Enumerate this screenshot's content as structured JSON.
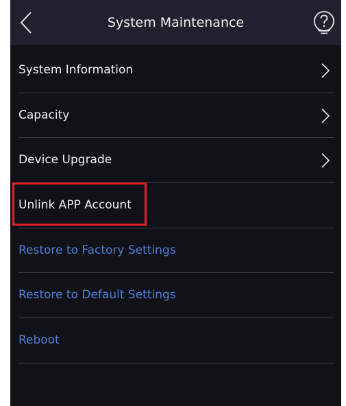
{
  "header": {
    "title": "System Maintenance",
    "back_icon": "chevron-left-icon",
    "help_icon": "help-icon"
  },
  "menu": {
    "items": [
      {
        "label": "System Information",
        "has_chevron": true,
        "color": "#f0f0f0"
      },
      {
        "label": "Capacity",
        "has_chevron": true,
        "color": "#f0f0f0"
      },
      {
        "label": "Device Upgrade",
        "has_chevron": true,
        "color": "#f0f0f0"
      },
      {
        "label": "Unlink APP Account",
        "has_chevron": false,
        "color": "#f0f0f0",
        "highlighted": true
      },
      {
        "label": "Restore to Factory Settings",
        "has_chevron": false,
        "color": "#4f7fd6"
      },
      {
        "label": "Restore to Default Settings",
        "has_chevron": false,
        "color": "#4f7fd6"
      },
      {
        "label": "Reboot",
        "has_chevron": false,
        "color": "#4f7fd6"
      }
    ]
  },
  "colors": {
    "background": "#111118",
    "header": "#20212e",
    "accent_link": "#4f7fd6",
    "highlight": "#e3202a"
  }
}
